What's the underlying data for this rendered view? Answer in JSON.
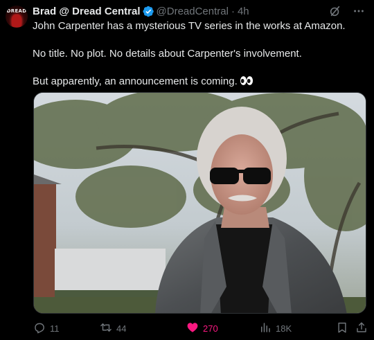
{
  "author": {
    "display_name": "Brad @ Dread Central",
    "handle": "@DreadCentral",
    "separator": "·",
    "time": "4h",
    "avatar_text": "DREAD"
  },
  "tweet": {
    "line1": "John Carpenter has a mysterious TV series in the works at Amazon.",
    "line2": "No title. No plot. No details about Carpenter's involvement.",
    "line3": "But apparently, an announcement is coming."
  },
  "icons": {
    "verified": "verified-badge-icon",
    "grok": "grok-icon",
    "more": "more-icon",
    "eyes": "eyes-emoji-icon",
    "reply": "reply-icon",
    "retweet": "retweet-icon",
    "like": "heart-icon",
    "views": "views-icon",
    "bookmark": "bookmark-icon",
    "share": "share-icon"
  },
  "actions": {
    "replies": "11",
    "retweets": "44",
    "likes": "270",
    "views": "18K"
  },
  "colors": {
    "background": "#000000",
    "text": "#e7e9ea",
    "muted": "#71767b",
    "verified": "#1d9bf0",
    "like_active": "#f91880"
  }
}
